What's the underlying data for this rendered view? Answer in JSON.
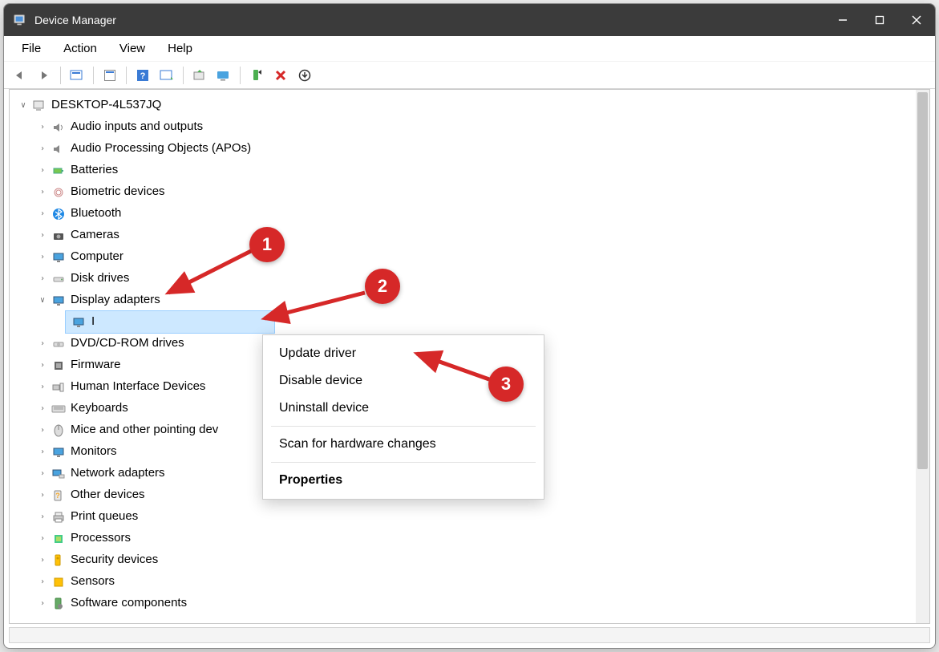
{
  "window": {
    "title": "Device Manager"
  },
  "menubar": {
    "file": "File",
    "action": "Action",
    "view": "View",
    "help": "Help"
  },
  "tree": {
    "root": "DESKTOP-4L537JQ",
    "categories": [
      {
        "label": "Audio inputs and outputs"
      },
      {
        "label": "Audio Processing Objects (APOs)"
      },
      {
        "label": "Batteries"
      },
      {
        "label": "Biometric devices"
      },
      {
        "label": "Bluetooth"
      },
      {
        "label": "Cameras"
      },
      {
        "label": "Computer"
      },
      {
        "label": "Disk drives"
      },
      {
        "label": "Display adapters",
        "expanded": true,
        "children": [
          {
            "label": "I"
          }
        ]
      },
      {
        "label": "DVD/CD-ROM drives"
      },
      {
        "label": "Firmware"
      },
      {
        "label": "Human Interface Devices"
      },
      {
        "label": "Keyboards"
      },
      {
        "label": "Mice and other pointing dev"
      },
      {
        "label": "Monitors"
      },
      {
        "label": "Network adapters"
      },
      {
        "label": "Other devices"
      },
      {
        "label": "Print queues"
      },
      {
        "label": "Processors"
      },
      {
        "label": "Security devices"
      },
      {
        "label": "Sensors"
      },
      {
        "label": "Software components"
      }
    ]
  },
  "contextmenu": {
    "items": [
      {
        "label": "Update driver"
      },
      {
        "label": "Disable device"
      },
      {
        "label": "Uninstall device"
      },
      {
        "sep": true
      },
      {
        "label": "Scan for hardware changes"
      },
      {
        "sep": true
      },
      {
        "label": "Properties",
        "bold": true
      }
    ]
  },
  "annotations": {
    "callouts": [
      {
        "n": "1"
      },
      {
        "n": "2"
      },
      {
        "n": "3"
      }
    ]
  }
}
